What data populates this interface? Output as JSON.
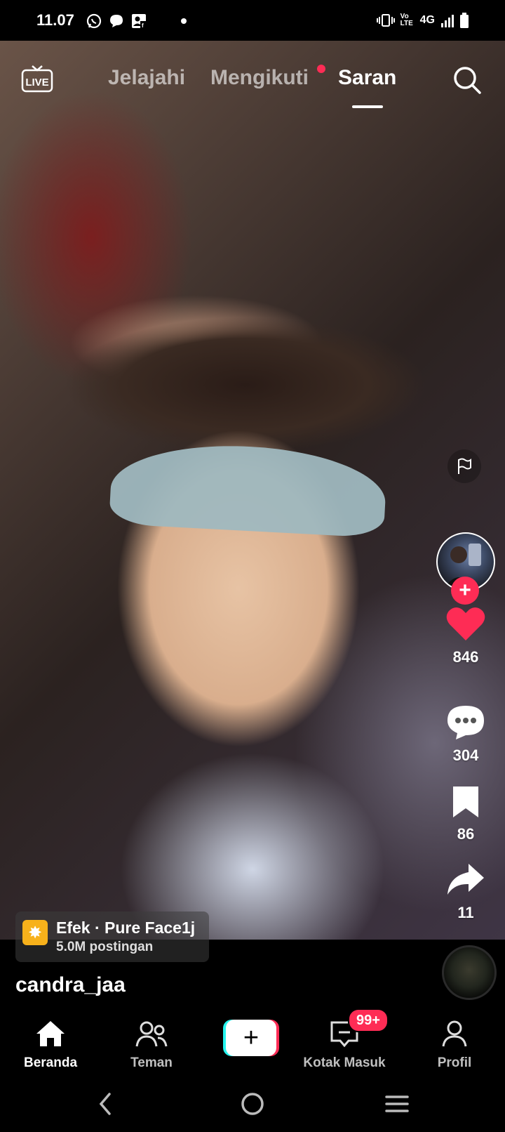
{
  "status_bar": {
    "time": "11.07",
    "left_icons": [
      "whatsapp-icon",
      "chat-icon",
      "facebook-contact-icon",
      "dot-icon"
    ],
    "right_icons": [
      "vibrate-icon",
      "volte-icon",
      "signal-icon",
      "battery-icon"
    ],
    "network": "4G",
    "volte": "Vo LTE"
  },
  "top_nav": {
    "live_label": "LIVE",
    "tabs": [
      {
        "label": "Jelajahi",
        "active": false
      },
      {
        "label": "Mengikuti",
        "active": false,
        "has_dot": true
      },
      {
        "label": "Saran",
        "active": true
      }
    ]
  },
  "side_actions": {
    "likes": "846",
    "comments": "304",
    "bookmarks": "86",
    "shares": "11",
    "follow_symbol": "+"
  },
  "effect": {
    "icon": "sparkle-icon",
    "title": "Efek · Pure Face1j",
    "subtitle": "5.0M postingan"
  },
  "video_info": {
    "username": "candra_jaa"
  },
  "bottom_nav": {
    "items": [
      {
        "label": "Beranda",
        "icon": "home-icon",
        "active": true
      },
      {
        "label": "Teman",
        "icon": "friends-icon",
        "active": false
      },
      {
        "label": "",
        "icon": "plus-icon",
        "active": false
      },
      {
        "label": "Kotak Masuk",
        "icon": "inbox-icon",
        "active": false,
        "badge": "99+"
      },
      {
        "label": "Profil",
        "icon": "profile-icon",
        "active": false
      }
    ],
    "create_symbol": "+"
  },
  "colors": {
    "accent": "#fe2c55",
    "cyan": "#25f4ee",
    "effect_icon": "#f7b11b"
  }
}
